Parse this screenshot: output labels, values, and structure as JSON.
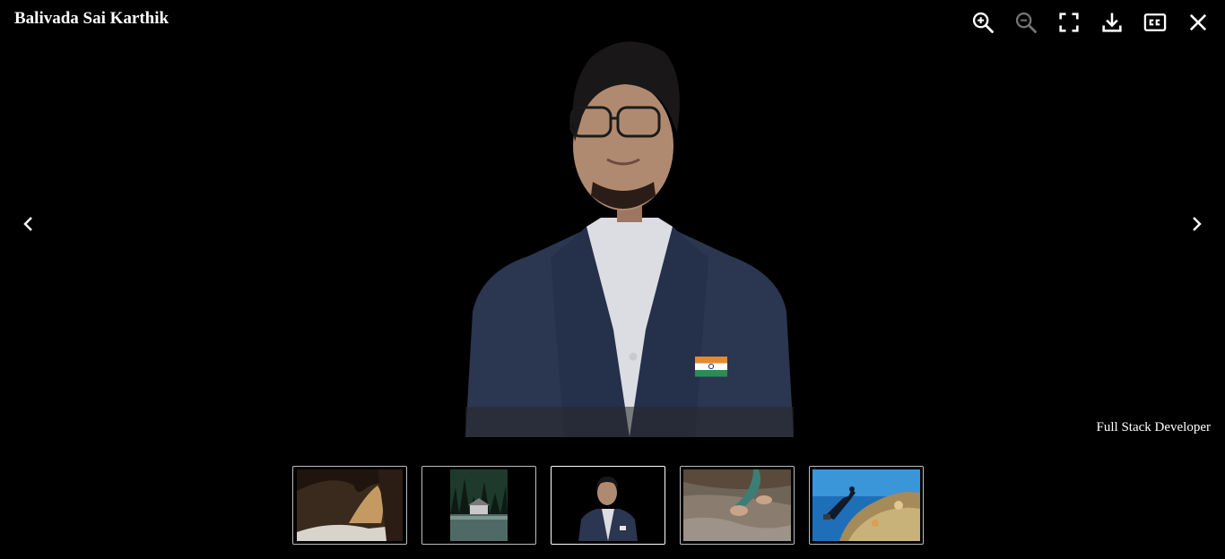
{
  "viewer": {
    "title": "Balivada Sai Karthik",
    "caption": "Full Stack Developer"
  },
  "toolbar": {
    "items": [
      {
        "name": "zoom-in-icon",
        "label": "Zoom in"
      },
      {
        "name": "zoom-out-icon",
        "label": "Zoom out"
      },
      {
        "name": "fullscreen-icon",
        "label": "Fullscreen"
      },
      {
        "name": "download-icon",
        "label": "Download"
      },
      {
        "name": "closed-captions-icon",
        "label": "Captions"
      },
      {
        "name": "close-icon",
        "label": "Close"
      }
    ]
  },
  "navigation": {
    "prev_icon": "chevron-left-icon",
    "next_icon": "chevron-right-icon"
  },
  "thumbnails": [
    {
      "name": "cave-photo",
      "active": false
    },
    {
      "name": "lake-cabin-photo",
      "active": false
    },
    {
      "name": "portrait-photo",
      "active": true
    },
    {
      "name": "hands-water-photo",
      "active": false
    },
    {
      "name": "underwater-diver-photo",
      "active": false
    }
  ],
  "colors": {
    "background": "#000000",
    "icon": "#ffffff",
    "thumb_border": "#bdbdbd"
  }
}
